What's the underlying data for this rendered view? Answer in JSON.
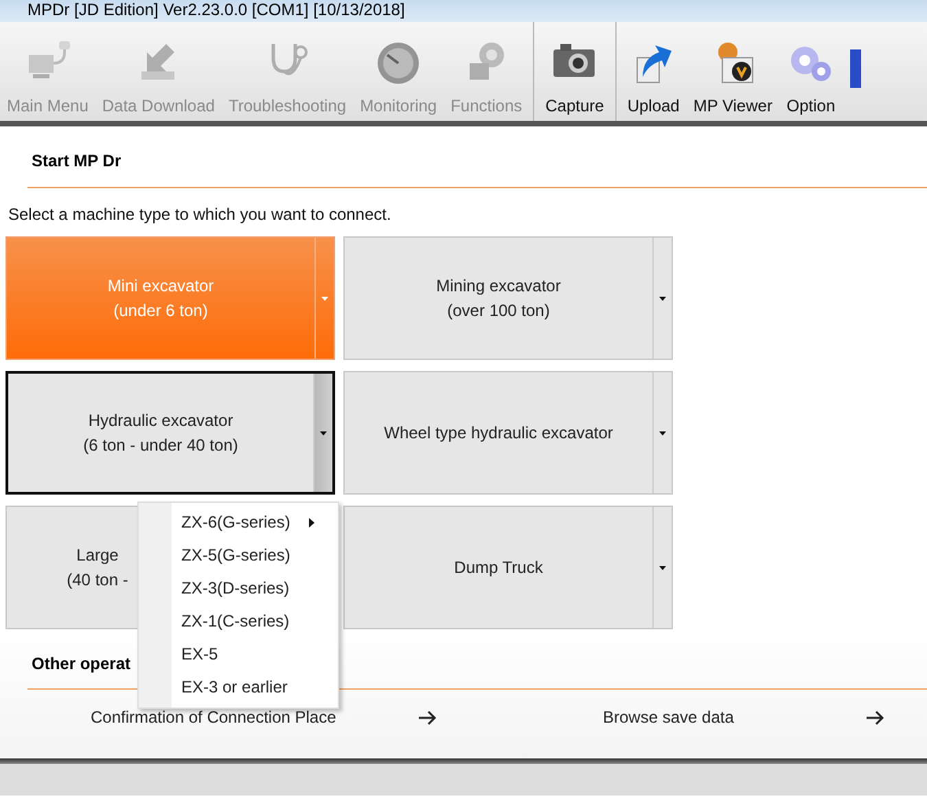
{
  "window": {
    "title": "MPDr [JD Edition] Ver2.23.0.0 [COM1] [10/13/2018]"
  },
  "toolbar": [
    {
      "label": "Main Menu",
      "disabled": true
    },
    {
      "label": "Data Download",
      "disabled": true
    },
    {
      "label": "Troubleshooting",
      "disabled": true
    },
    {
      "label": "Monitoring",
      "disabled": true
    },
    {
      "label": "Functions",
      "disabled": true
    },
    {
      "label": "Capture",
      "disabled": false
    },
    {
      "label": "Upload",
      "disabled": false
    },
    {
      "label": "MP Viewer",
      "disabled": false
    },
    {
      "label": "Option",
      "disabled": false
    }
  ],
  "start": {
    "heading": "Start MP Dr",
    "instruction": "Select a machine type to which you want to connect.",
    "machines": [
      {
        "lines": [
          "Mini excavator",
          "(under 6 ton)"
        ],
        "selected": true,
        "focused": false
      },
      {
        "lines": [
          "Mining excavator",
          "(over 100 ton)"
        ],
        "selected": false,
        "focused": false
      },
      {
        "lines": [
          "Hydraulic excavator",
          "(6 ton - under 40 ton)"
        ],
        "selected": false,
        "focused": true
      },
      {
        "lines": [
          "Wheel type hydraulic excavator"
        ],
        "selected": false,
        "focused": false
      },
      {
        "lines": [
          "Large",
          "(40 ton -"
        ],
        "selected": false,
        "focused": false
      },
      {
        "lines": [
          "Dump Truck"
        ],
        "selected": false,
        "focused": false
      }
    ]
  },
  "menu": {
    "items": [
      {
        "label": "ZX-6(G-series)",
        "submenu": true
      },
      {
        "label": "ZX-5(G-series)",
        "submenu": false
      },
      {
        "label": "ZX-3(D-series)",
        "submenu": false
      },
      {
        "label": "ZX-1(C-series)",
        "submenu": false
      },
      {
        "label": "EX-5",
        "submenu": false
      },
      {
        "label": "EX-3 or earlier",
        "submenu": false
      }
    ]
  },
  "other": {
    "heading": "Other operat",
    "links": [
      {
        "label": "Confirmation of Connection Place"
      },
      {
        "label": "Browse save data"
      }
    ]
  }
}
